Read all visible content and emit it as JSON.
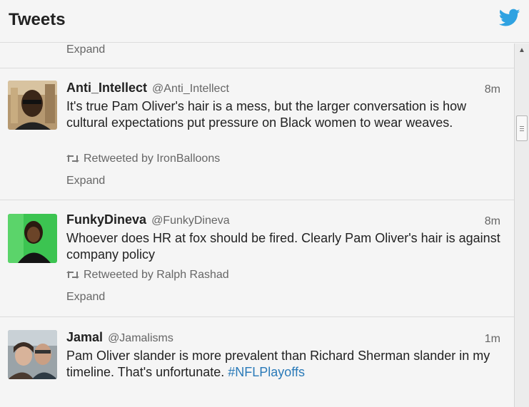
{
  "header": {
    "title": "Tweets",
    "logo_icon": "twitter-bird-icon",
    "brand_color": "#2fa2e1"
  },
  "stream": {
    "top_expand_label": "Expand",
    "tweets": [
      {
        "name": "Anti_Intellect",
        "handle": "@Anti_Intellect",
        "time": "8m",
        "text": "It's true Pam Oliver's hair is a mess, but the larger conversation is how cultural expectations put pressure on Black women to wear weaves.",
        "retweeted_by": "Retweeted by IronBalloons",
        "expand_label": "Expand"
      },
      {
        "name": "FunkyDineva",
        "handle": "@FunkyDineva",
        "time": "8m",
        "text": "Whoever does HR at fox should be fired. Clearly Pam Oliver's hair is against company policy",
        "retweeted_by": "Retweeted by Ralph Rashad",
        "expand_label": "Expand"
      },
      {
        "name": "Jamal",
        "handle": "@Jamalisms",
        "time": "1m",
        "text": "Pam Oliver slander is more prevalent than Richard Sherman slander in my timeline. That's unfortunate.",
        "hashtag": "#NFLPlayoffs"
      }
    ]
  },
  "colors": {
    "hashtag": "#2a7ab8",
    "muted_text": "#666666",
    "primary_text": "#222222"
  }
}
